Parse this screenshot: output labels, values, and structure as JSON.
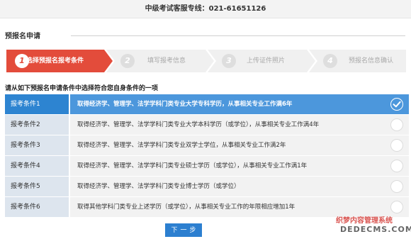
{
  "header": {
    "hotline": "中级考试客服专线：021-61651126"
  },
  "section": {
    "title": "预报名申请"
  },
  "steps": [
    {
      "num": "1",
      "label": "选择预报名报考条件",
      "active": true
    },
    {
      "num": "2",
      "label": "填写报考信息",
      "active": false
    },
    {
      "num": "3",
      "label": "上传证件照片",
      "active": false
    },
    {
      "num": "4",
      "label": "预报名信息确认",
      "active": false
    }
  ],
  "instruction": "请从如下预报名申请条件中选择符合您自身条件的一项",
  "conditions": [
    {
      "name": "报考条件1",
      "text": "取得经济学、管理学、法学学科门类专业大学专科学历，从事相关专业工作满6年",
      "selected": true
    },
    {
      "name": "报考条件2",
      "text": "取得经济学、管理学、法学学科门类专业大学本科学历（或学位），从事相关专业工作满4年",
      "selected": false
    },
    {
      "name": "报考条件3",
      "text": "取得经济学、管理学、法学学科门类专业双学士学位，从事相关专业工作满2年",
      "selected": false
    },
    {
      "name": "报考条件4",
      "text": "取得经济学、管理学、法学学科门类专业硕士学历（或学位），从事相关专业工作满1年",
      "selected": false
    },
    {
      "name": "报考条件5",
      "text": "取得经济学、管理学、法学学科门类专业博士学历（或学位）",
      "selected": false
    },
    {
      "name": "报考条件6",
      "text": "取得其他学科门类专业上述学历（或学位），从事相关专业工作的年限相应增加1年",
      "selected": false
    }
  ],
  "next_button": {
    "label": "下一步"
  },
  "watermark": {
    "cn": "织梦内容管理系统",
    "en": "DEDECMS.COM"
  },
  "colors": {
    "active_step": "#e34c3b",
    "selected_row": "#4c97dc",
    "button": "#2c7fd0"
  },
  "icons": {
    "selected": "check-icon",
    "unselected": "radio-empty-icon"
  }
}
